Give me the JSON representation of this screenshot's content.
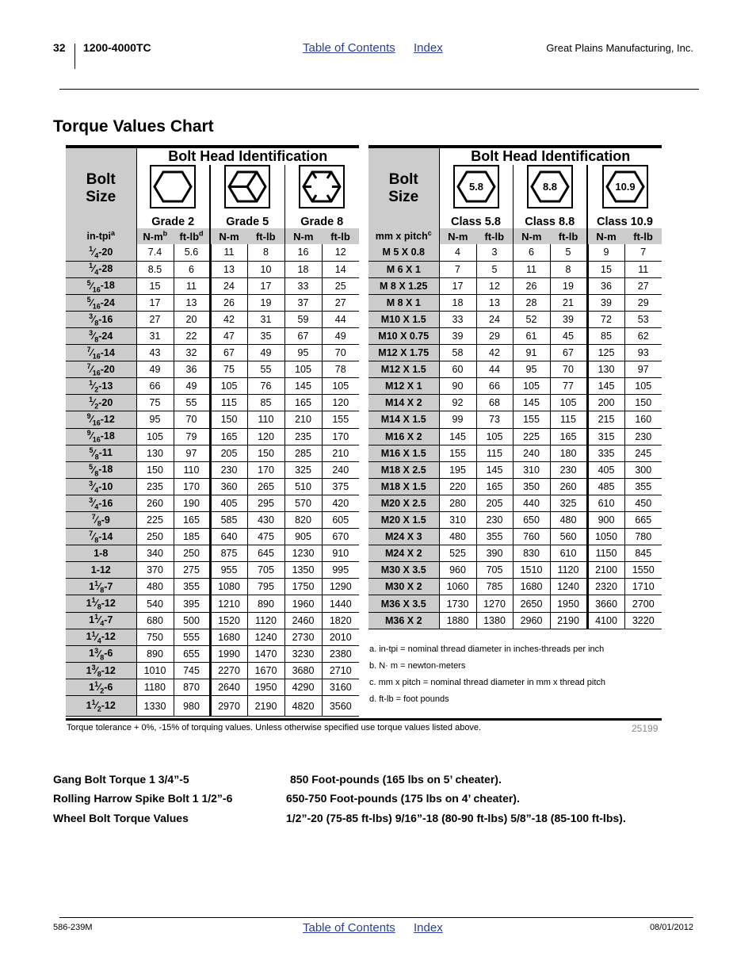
{
  "header": {
    "page_number": "32",
    "doc_id": "1200-4000TC",
    "toc_link": "Table of Contents",
    "index_link": "Index",
    "company": "Great Plains Manufacturing, Inc."
  },
  "page_title": "Torque Values Chart",
  "sae_table": {
    "size_header_line1": "Bolt",
    "size_header_line2": "Size",
    "bolt_head_title": "Bolt Head Identification",
    "grades": [
      "Grade 2",
      "Grade 5",
      "Grade 8"
    ],
    "grade_icons": [
      "hex-plain-icon",
      "hex-3-lines-icon",
      "hex-6-lines-icon"
    ],
    "size_unit": "in-tpi",
    "size_unit_footnote": "a",
    "units": [
      {
        "label": "N-m",
        "footnote": "b"
      },
      {
        "label": "ft-lb",
        "footnote": "d"
      },
      {
        "label": "N-m",
        "footnote": ""
      },
      {
        "label": "ft-lb",
        "footnote": ""
      },
      {
        "label": "N-m",
        "footnote": ""
      },
      {
        "label": "ft-lb",
        "footnote": ""
      }
    ],
    "rows": [
      {
        "whole": "",
        "num": "1",
        "den": "4",
        "tpi": "-20",
        "values": [
          "7.4",
          "5.6",
          "11",
          "8",
          "16",
          "12"
        ]
      },
      {
        "whole": "",
        "num": "1",
        "den": "4",
        "tpi": "-28",
        "values": [
          "8.5",
          "6",
          "13",
          "10",
          "18",
          "14"
        ]
      },
      {
        "whole": "",
        "num": "5",
        "den": "16",
        "tpi": "-18",
        "values": [
          "15",
          "11",
          "24",
          "17",
          "33",
          "25"
        ]
      },
      {
        "whole": "",
        "num": "5",
        "den": "16",
        "tpi": "-24",
        "values": [
          "17",
          "13",
          "26",
          "19",
          "37",
          "27"
        ]
      },
      {
        "whole": "",
        "num": "3",
        "den": "8",
        "tpi": "-16",
        "values": [
          "27",
          "20",
          "42",
          "31",
          "59",
          "44"
        ]
      },
      {
        "whole": "",
        "num": "3",
        "den": "8",
        "tpi": "-24",
        "values": [
          "31",
          "22",
          "47",
          "35",
          "67",
          "49"
        ]
      },
      {
        "whole": "",
        "num": "7",
        "den": "16",
        "tpi": "-14",
        "values": [
          "43",
          "32",
          "67",
          "49",
          "95",
          "70"
        ]
      },
      {
        "whole": "",
        "num": "7",
        "den": "16",
        "tpi": "-20",
        "values": [
          "49",
          "36",
          "75",
          "55",
          "105",
          "78"
        ]
      },
      {
        "whole": "",
        "num": "1",
        "den": "2",
        "tpi": "-13",
        "values": [
          "66",
          "49",
          "105",
          "76",
          "145",
          "105"
        ]
      },
      {
        "whole": "",
        "num": "1",
        "den": "2",
        "tpi": "-20",
        "values": [
          "75",
          "55",
          "115",
          "85",
          "165",
          "120"
        ]
      },
      {
        "whole": "",
        "num": "9",
        "den": "16",
        "tpi": "-12",
        "values": [
          "95",
          "70",
          "150",
          "110",
          "210",
          "155"
        ]
      },
      {
        "whole": "",
        "num": "9",
        "den": "16",
        "tpi": "-18",
        "values": [
          "105",
          "79",
          "165",
          "120",
          "235",
          "170"
        ]
      },
      {
        "whole": "",
        "num": "5",
        "den": "8",
        "tpi": "-11",
        "values": [
          "130",
          "97",
          "205",
          "150",
          "285",
          "210"
        ]
      },
      {
        "whole": "",
        "num": "5",
        "den": "8",
        "tpi": "-18",
        "values": [
          "150",
          "110",
          "230",
          "170",
          "325",
          "240"
        ]
      },
      {
        "whole": "",
        "num": "3",
        "den": "4",
        "tpi": "-10",
        "values": [
          "235",
          "170",
          "360",
          "265",
          "510",
          "375"
        ]
      },
      {
        "whole": "",
        "num": "3",
        "den": "4",
        "tpi": "-16",
        "values": [
          "260",
          "190",
          "405",
          "295",
          "570",
          "420"
        ]
      },
      {
        "whole": "",
        "num": "7",
        "den": "8",
        "tpi": "-9",
        "values": [
          "225",
          "165",
          "585",
          "430",
          "820",
          "605"
        ]
      },
      {
        "whole": "",
        "num": "7",
        "den": "8",
        "tpi": "-14",
        "values": [
          "250",
          "185",
          "640",
          "475",
          "905",
          "670"
        ]
      },
      {
        "whole": "1",
        "num": "",
        "den": "",
        "tpi": "-8",
        "values": [
          "340",
          "250",
          "875",
          "645",
          "1230",
          "910"
        ]
      },
      {
        "whole": "1",
        "num": "",
        "den": "",
        "tpi": "-12",
        "values": [
          "370",
          "275",
          "955",
          "705",
          "1350",
          "995"
        ]
      },
      {
        "whole": "1",
        "num": "1",
        "den": "8",
        "tpi": "-7",
        "values": [
          "480",
          "355",
          "1080",
          "795",
          "1750",
          "1290"
        ]
      },
      {
        "whole": "1",
        "num": "1",
        "den": "8",
        "tpi": "-12",
        "values": [
          "540",
          "395",
          "1210",
          "890",
          "1960",
          "1440"
        ]
      },
      {
        "whole": "1",
        "num": "1",
        "den": "4",
        "tpi": "-7",
        "values": [
          "680",
          "500",
          "1520",
          "1120",
          "2460",
          "1820"
        ]
      },
      {
        "whole": "1",
        "num": "1",
        "den": "4",
        "tpi": "-12",
        "values": [
          "750",
          "555",
          "1680",
          "1240",
          "2730",
          "2010"
        ]
      },
      {
        "whole": "1",
        "num": "3",
        "den": "8",
        "tpi": "-6",
        "values": [
          "890",
          "655",
          "1990",
          "1470",
          "3230",
          "2380"
        ]
      },
      {
        "whole": "1",
        "num": "3",
        "den": "8",
        "tpi": "-12",
        "values": [
          "1010",
          "745",
          "2270",
          "1670",
          "3680",
          "2710"
        ]
      },
      {
        "whole": "1",
        "num": "1",
        "den": "2",
        "tpi": "-6",
        "values": [
          "1180",
          "870",
          "2640",
          "1950",
          "4290",
          "3160"
        ]
      },
      {
        "whole": "1",
        "num": "1",
        "den": "2",
        "tpi": "-12",
        "values": [
          "1330",
          "980",
          "2970",
          "2190",
          "4820",
          "3560"
        ]
      }
    ]
  },
  "metric_table": {
    "size_header_line1": "Bolt",
    "size_header_line2": "Size",
    "bolt_head_title": "Bolt Head Identification",
    "grades": [
      "Class 5.8",
      "Class 8.8",
      "Class 10.9"
    ],
    "grade_marks": [
      "5.8",
      "8.8",
      "10.9"
    ],
    "size_unit": "mm x pitch",
    "size_unit_footnote": "c",
    "units": [
      {
        "label": "N-m",
        "footnote": ""
      },
      {
        "label": "ft-lb",
        "footnote": ""
      },
      {
        "label": "N-m",
        "footnote": ""
      },
      {
        "label": "ft-lb",
        "footnote": ""
      },
      {
        "label": "N-m",
        "footnote": ""
      },
      {
        "label": "ft-lb",
        "footnote": ""
      }
    ],
    "rows": [
      {
        "size": "M 5 X 0.8",
        "values": [
          "4",
          "3",
          "6",
          "5",
          "9",
          "7"
        ]
      },
      {
        "size": "M 6 X 1",
        "values": [
          "7",
          "5",
          "11",
          "8",
          "15",
          "11"
        ]
      },
      {
        "size": "M 8 X 1.25",
        "values": [
          "17",
          "12",
          "26",
          "19",
          "36",
          "27"
        ]
      },
      {
        "size": "M 8 X 1",
        "values": [
          "18",
          "13",
          "28",
          "21",
          "39",
          "29"
        ]
      },
      {
        "size": "M10 X 1.5",
        "values": [
          "33",
          "24",
          "52",
          "39",
          "72",
          "53"
        ]
      },
      {
        "size": "M10 X 0.75",
        "values": [
          "39",
          "29",
          "61",
          "45",
          "85",
          "62"
        ]
      },
      {
        "size": "M12 X 1.75",
        "values": [
          "58",
          "42",
          "91",
          "67",
          "125",
          "93"
        ]
      },
      {
        "size": "M12 X 1.5",
        "values": [
          "60",
          "44",
          "95",
          "70",
          "130",
          "97"
        ]
      },
      {
        "size": "M12 X 1",
        "values": [
          "90",
          "66",
          "105",
          "77",
          "145",
          "105"
        ]
      },
      {
        "size": "M14 X 2",
        "values": [
          "92",
          "68",
          "145",
          "105",
          "200",
          "150"
        ]
      },
      {
        "size": "M14 X 1.5",
        "values": [
          "99",
          "73",
          "155",
          "115",
          "215",
          "160"
        ]
      },
      {
        "size": "M16 X 2",
        "values": [
          "145",
          "105",
          "225",
          "165",
          "315",
          "230"
        ]
      },
      {
        "size": "M16 X 1.5",
        "values": [
          "155",
          "115",
          "240",
          "180",
          "335",
          "245"
        ]
      },
      {
        "size": "M18 X 2.5",
        "values": [
          "195",
          "145",
          "310",
          "230",
          "405",
          "300"
        ]
      },
      {
        "size": "M18 X 1.5",
        "values": [
          "220",
          "165",
          "350",
          "260",
          "485",
          "355"
        ]
      },
      {
        "size": "M20 X 2.5",
        "values": [
          "280",
          "205",
          "440",
          "325",
          "610",
          "450"
        ]
      },
      {
        "size": "M20 X 1.5",
        "values": [
          "310",
          "230",
          "650",
          "480",
          "900",
          "665"
        ]
      },
      {
        "size": "M24 X 3",
        "values": [
          "480",
          "355",
          "760",
          "560",
          "1050",
          "780"
        ]
      },
      {
        "size": "M24 X 2",
        "values": [
          "525",
          "390",
          "830",
          "610",
          "1150",
          "845"
        ]
      },
      {
        "size": "M30 X 3.5",
        "values": [
          "960",
          "705",
          "1510",
          "1120",
          "2100",
          "1550"
        ]
      },
      {
        "size": "M30 X 2",
        "values": [
          "1060",
          "785",
          "1680",
          "1240",
          "2320",
          "1710"
        ]
      },
      {
        "size": "M36 X 3.5",
        "values": [
          "1730",
          "1270",
          "2650",
          "1950",
          "3660",
          "2700"
        ]
      },
      {
        "size": "M36 X 2",
        "values": [
          "1880",
          "1380",
          "2960",
          "2190",
          "4100",
          "3220"
        ]
      }
    ]
  },
  "footnotes": [
    "a.  in-tpi = nominal thread diameter in inches-threads per inch",
    "b.  N· m = newton-meters",
    "c.  mm x pitch = nominal thread diameter in mm x thread  pitch",
    "d.  ft-lb = foot pounds"
  ],
  "tolerance_note": "Torque tolerance + 0%, -15% of torquing values. Unless otherwise specified use torque values listed above.",
  "figure_number": "25199",
  "notes": [
    {
      "label": "Gang Bolt Torque 1 3/4”-5",
      "value": "850 Foot-pounds   (165 lbs on 5’ cheater)."
    },
    {
      "label": "Rolling Harrow Spike Bolt 1 1/2”-6",
      "value": "650-750 Foot-pounds   (175 lbs on 4’ cheater)."
    },
    {
      "label": "Wheel Bolt Torque Values",
      "value": "1/2”-20 (75-85 ft-lbs) 9/16”-18 (80-90 ft-lbs) 5/8”-18 (85-100 ft-lbs)."
    }
  ],
  "footer": {
    "doc_number": "586-239M",
    "toc_link": "Table of Contents",
    "index_link": "Index",
    "date": "08/01/2012"
  }
}
